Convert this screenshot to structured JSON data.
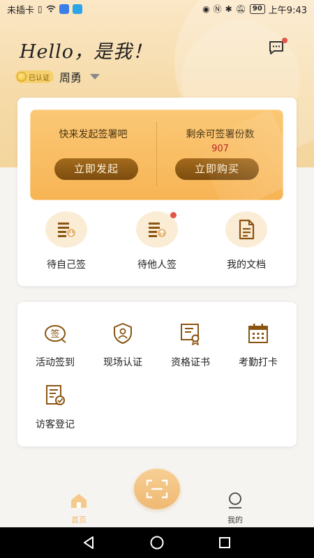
{
  "status_bar": {
    "carrier": "未插卡",
    "battery": "90",
    "time": "上午9:43"
  },
  "header": {
    "greeting": "Hello，是我！",
    "verified_label": "已认证",
    "user_name": "周勇"
  },
  "banner": {
    "left_title": "快来发起签署吧",
    "left_button": "立即发起",
    "right_title": "剩余可签署份数",
    "right_count": "907",
    "right_button": "立即购买"
  },
  "quick_actions": [
    {
      "label": "待自己签",
      "icon": "sign-self-icon",
      "badge": false
    },
    {
      "label": "待他人签",
      "icon": "sign-others-icon",
      "badge": true
    },
    {
      "label": "我的文档",
      "icon": "document-icon",
      "badge": false
    }
  ],
  "services": [
    {
      "label": "活动签到",
      "icon": "checkin-icon"
    },
    {
      "label": "现场认证",
      "icon": "face-shield-icon"
    },
    {
      "label": "资格证书",
      "icon": "certificate-icon"
    },
    {
      "label": "考勤打卡",
      "icon": "calendar-icon"
    },
    {
      "label": "访客登记",
      "icon": "visitor-register-icon"
    }
  ],
  "bottom_nav": {
    "home_label": "首页",
    "mine_label": "我的"
  },
  "colors": {
    "accent": "#f7b454",
    "button_dark": "#8b5713",
    "icon_brown": "#8a5512",
    "nav_active": "#f0b773",
    "badge_red": "#e2574c"
  }
}
